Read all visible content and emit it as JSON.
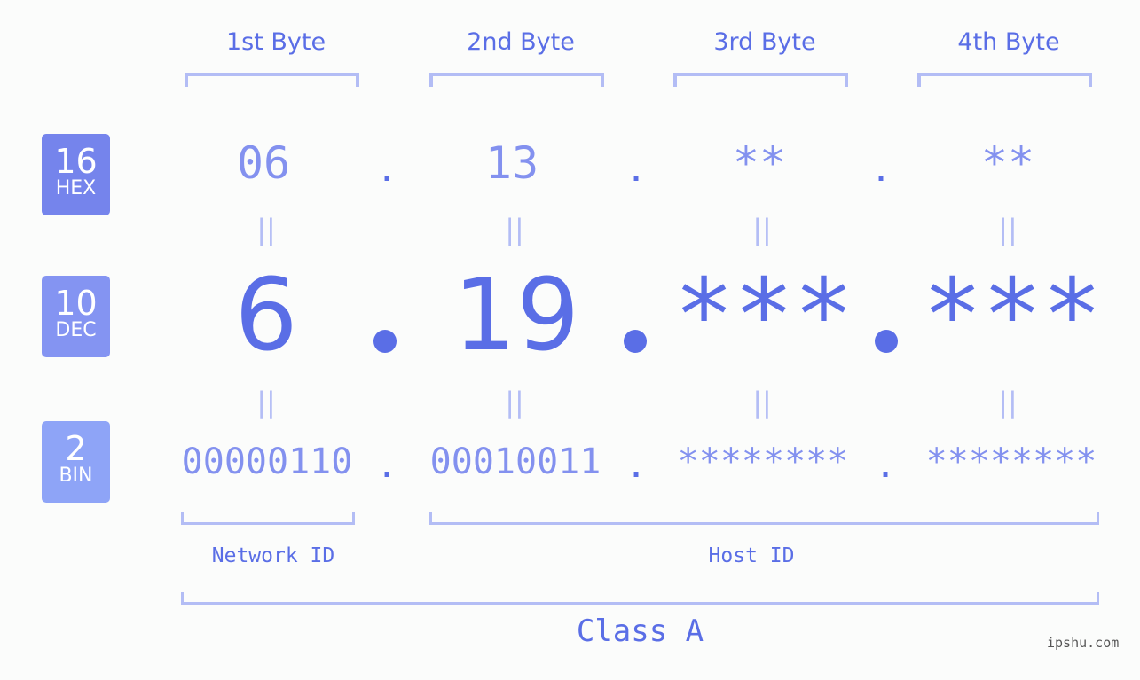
{
  "header": {
    "bytes": [
      "1st Byte",
      "2nd Byte",
      "3rd Byte",
      "4th Byte"
    ]
  },
  "badges": {
    "hex": {
      "num": "16",
      "unit": "HEX",
      "color": "#7584ec"
    },
    "dec": {
      "num": "10",
      "unit": "DEC",
      "color": "#8494f2"
    },
    "bin": {
      "num": "2",
      "unit": "BIN",
      "color": "#8ea4f7"
    }
  },
  "hex": [
    "06",
    "13",
    "**",
    "**"
  ],
  "dec": [
    "6",
    "19",
    "***",
    "***"
  ],
  "bin": [
    "00000110",
    "00010011",
    "********",
    "********"
  ],
  "separator": ".",
  "equals": "||",
  "labels": {
    "network_id": "Network ID",
    "host_id": "Host ID",
    "class": "Class A"
  },
  "watermark": "ipshu.com",
  "colors": {
    "primary": "#5a6ee6",
    "secondary": "#8391ef",
    "bracket": "#b3bdf5",
    "background": "#fbfcfb"
  }
}
